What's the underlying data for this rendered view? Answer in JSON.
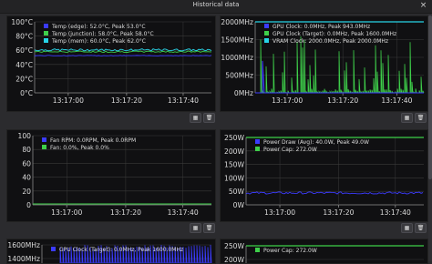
{
  "window": {
    "title": "Historical data",
    "close_glyph": "×"
  },
  "colors": {
    "blue": "#3b3bff",
    "green": "#3ecf4a",
    "cyan": "#27d3e6",
    "grid": "#3a3a3a"
  },
  "panels": [
    {
      "id": "temp",
      "yticks": [
        "100°C",
        "80°C",
        "60°C",
        "40°C",
        "20°C",
        "0°C"
      ],
      "xticks": [
        "13:17:00",
        "13:17:20",
        "13:17:40"
      ],
      "legend": [
        {
          "label": "Temp (edge): 52.0°C, Peak 53.0°C",
          "color": "#3b3bff"
        },
        {
          "label": "Temp (junction): 58.0°C, Peak 58.0°C",
          "color": "#3ecf4a"
        },
        {
          "label": "Temp (mem): 60.0°C, Peak 62.0°C",
          "color": "#27d3e6"
        }
      ]
    },
    {
      "id": "clock",
      "yticks": [
        "2000MHz",
        "1500MHz",
        "1000MHz",
        "500MHz",
        "0MHz"
      ],
      "xticks": [
        "13:17:00",
        "13:17:20",
        "13:17:40"
      ],
      "legend": [
        {
          "label": "GPU Clock: 0.0MHz, Peak 943.0MHz",
          "color": "#3b3bff"
        },
        {
          "label": "GPU Clock (Target): 0.0MHz, Peak 1600.0MHz",
          "color": "#3ecf4a"
        },
        {
          "label": "VRAM Clock: 2000.0MHz, Peak 2000.0MHz",
          "color": "#27d3e6"
        }
      ]
    },
    {
      "id": "fan",
      "yticks": [
        "100",
        "80",
        "60",
        "40",
        "20",
        "0"
      ],
      "xticks": [
        "13:17:00",
        "13:17:20",
        "13:17:40"
      ],
      "legend": [
        {
          "label": "Fan RPM: 0.0RPM, Peak 0.0RPM",
          "color": "#3b3bff"
        },
        {
          "label": "Fan: 0.0%, Peak 0.0%",
          "color": "#3ecf4a"
        }
      ]
    },
    {
      "id": "power",
      "yticks": [
        "250W",
        "200W",
        "150W",
        "100W",
        "50W",
        "0W"
      ],
      "xticks": [
        "13:17:00",
        "13:17:20",
        "13:17:40"
      ],
      "legend": [
        {
          "label": "Power Draw (Avg): 40.0W, Peak 49.0W",
          "color": "#3b3bff"
        },
        {
          "label": "Power Cap: 272.0W",
          "color": "#3ecf4a"
        }
      ]
    },
    {
      "id": "clock2",
      "yticks": [
        "1600MHz",
        "1400MHz"
      ],
      "xticks": [],
      "legend": [
        {
          "label": "GPU Clock (Target): 0.0MHz, Peak 1600.0MHz",
          "color": "#3b3bff"
        }
      ]
    },
    {
      "id": "power2",
      "yticks": [
        "250W",
        "200W"
      ],
      "xticks": [],
      "legend": [
        {
          "label": "Power Cap: 272.0W",
          "color": "#3ecf4a"
        }
      ]
    }
  ],
  "buttons": {
    "settings_glyph": "▦",
    "delete_glyph": "🗑"
  },
  "icons": {
    "settings": "grid-settings-icon",
    "delete": "trash-icon",
    "close": "close-icon"
  }
}
